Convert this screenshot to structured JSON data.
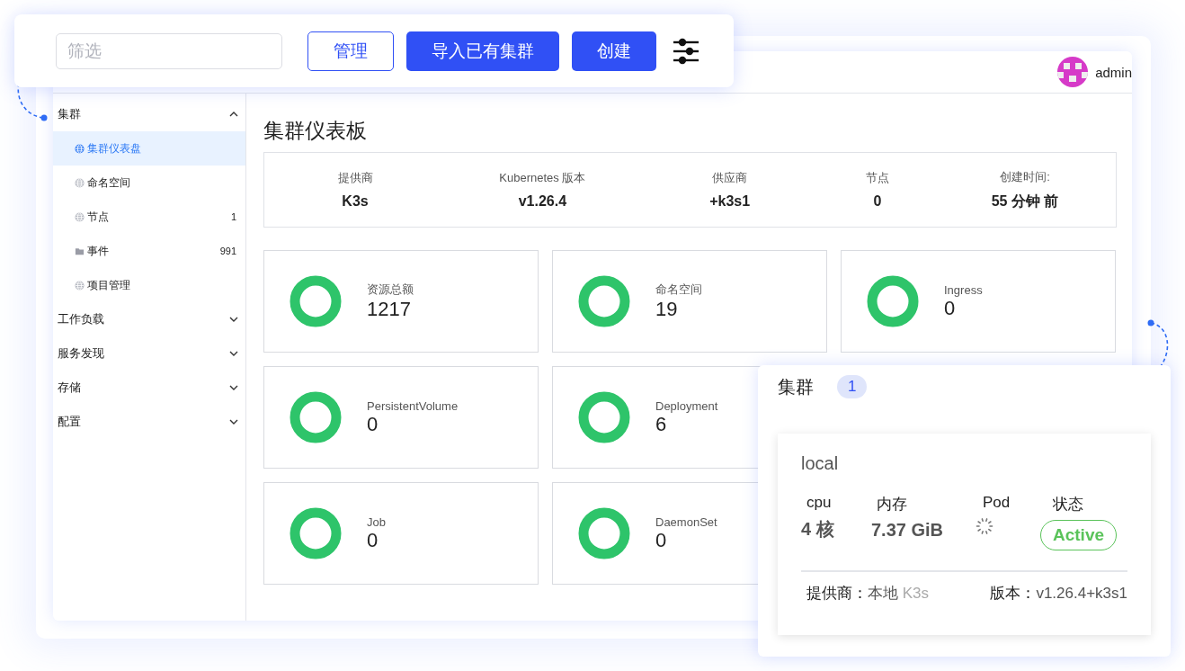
{
  "toolbar": {
    "filter": {
      "placeholder": "筛选"
    },
    "buttons": [
      {
        "label": "管理",
        "kind": "outline"
      },
      {
        "label": "导入已有集群",
        "kind": "primary"
      },
      {
        "label": "创建",
        "kind": "primary"
      }
    ]
  },
  "header": {
    "user": "admin"
  },
  "sidebar": {
    "groups": [
      {
        "label": "集群",
        "expanded": true,
        "children": [
          {
            "label": "集群仪表盘",
            "kind": "resource",
            "selected": true
          },
          {
            "label": "命名空间",
            "kind": "resource",
            "selected": false
          },
          {
            "label": "节点",
            "kind": "resource",
            "selected": false,
            "count": "1"
          },
          {
            "label": "事件",
            "kind": "folder",
            "selected": false,
            "count": "991"
          },
          {
            "label": "项目管理",
            "kind": "resource",
            "selected": false
          }
        ]
      },
      {
        "label": "工作负载",
        "expanded": false
      },
      {
        "label": "服务发现",
        "expanded": false
      },
      {
        "label": "存储",
        "expanded": false
      },
      {
        "label": "配置",
        "expanded": false
      }
    ]
  },
  "page": {
    "title": "集群仪表板",
    "summary": [
      {
        "label": "提供商",
        "value": "K3s"
      },
      {
        "label": "Kubernetes 版本",
        "value": "v1.26.4"
      },
      {
        "label": "供应商",
        "value": "+k3s1"
      },
      {
        "label": "节点",
        "value": "0"
      },
      {
        "label": "创建时间:",
        "value": "55 分钟 前"
      }
    ],
    "cards": [
      {
        "label": "资源总额",
        "value": "1217"
      },
      {
        "label": "命名空间",
        "value": "19"
      },
      {
        "label": "Ingress",
        "value": "0"
      },
      {
        "label": "PersistentVolume",
        "value": "0"
      },
      {
        "label": "Deployment",
        "value": "6"
      },
      {
        "label": "Job",
        "value": "0"
      },
      {
        "label": "DaemonSet",
        "value": "0"
      }
    ]
  },
  "cluster_panel": {
    "title": "集群",
    "count": "1",
    "cluster": {
      "name": "local",
      "stats": [
        {
          "label": "cpu",
          "value": "4 核",
          "kind": "text"
        },
        {
          "label": "内存",
          "value": "7.37 GiB",
          "kind": "text"
        },
        {
          "label": "Pod",
          "kind": "spinner"
        },
        {
          "label": "状态",
          "value": "Active",
          "kind": "badge"
        }
      ],
      "provider_label": "提供商：",
      "provider_value": "本地",
      "provider_name": "K3s",
      "version_label": "版本：",
      "version_value": "v1.26.4+k3s1"
    }
  }
}
